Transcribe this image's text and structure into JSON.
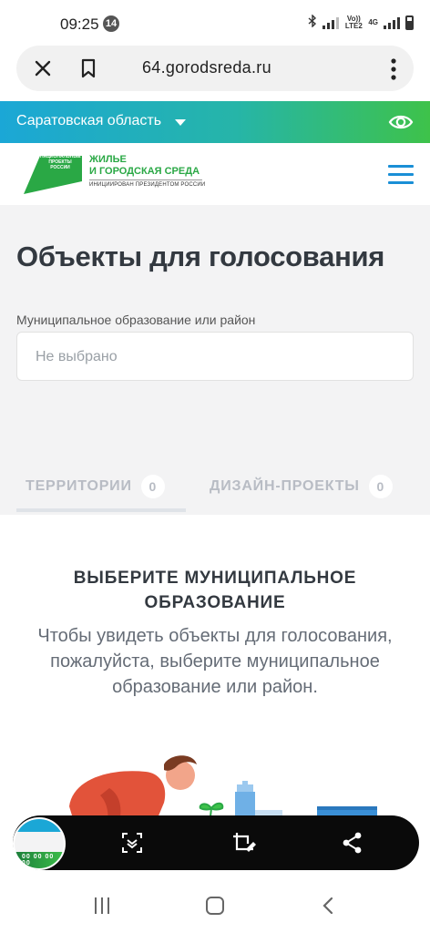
{
  "status": {
    "time": "09:25",
    "notification_count": "14",
    "network_label": "Vo)) LTE2",
    "network_gen": "4G"
  },
  "browser": {
    "url": "64.gorodsreda.ru"
  },
  "region": {
    "label": "Саратовская область"
  },
  "logo": {
    "mark_text": "НАЦИОНАЛЬНЫЕ ПРОЕКТЫ РОССИИ",
    "title_line1": "ЖИЛЬЕ",
    "title_line2": "И ГОРОДСКАЯ СРЕДА",
    "subtitle": "ИНИЦИИРОВАН ПРЕЗИДЕНТОМ РОССИИ"
  },
  "main": {
    "title": "Объекты для голосования",
    "field_label": "Муниципальное образование или район",
    "select_value": "Не выбрано",
    "tabs": [
      {
        "label": "ТЕРРИТОРИИ",
        "count": "0"
      },
      {
        "label": "ДИЗАЙН-ПРОЕКТЫ",
        "count": "0"
      }
    ],
    "empty_title": "ВЫБЕРИТЕ МУНИЦИПАЛЬНОЕ ОБРАЗОВАНИЕ",
    "empty_text": "Чтобы увидеть объекты для голосования, пожалуйста, выберите муниципальное образование или район."
  },
  "screenshot_toolbar": {
    "thumb_count": "00 00 00 00"
  },
  "colors": {
    "brand_green": "#2aa845",
    "brand_blue": "#1ba7d6",
    "hamburger_blue": "#1a8fd6"
  }
}
